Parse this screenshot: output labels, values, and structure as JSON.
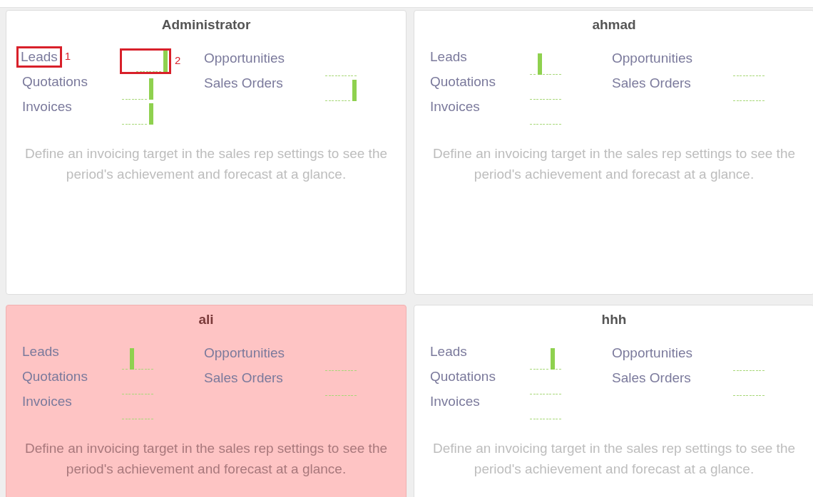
{
  "cards": [
    {
      "title": "Administrator",
      "highlighted": false,
      "left": [
        {
          "label": "Leads",
          "kind": "last",
          "label_marker": "1",
          "chart_marker": "2"
        },
        {
          "label": "Quotations",
          "kind": "last"
        },
        {
          "label": "Invoices",
          "kind": "last"
        }
      ],
      "right": [
        {
          "label": "Opportunities",
          "kind": "flat"
        },
        {
          "label": "Sales Orders",
          "kind": "last"
        }
      ],
      "message": "Define an invoicing target in the sales rep settings to see the period's achievement and forecast at a glance."
    },
    {
      "title": "ahmad",
      "highlighted": false,
      "left": [
        {
          "label": "Leads",
          "kind": "second"
        },
        {
          "label": "Quotations",
          "kind": "flat"
        },
        {
          "label": "Invoices",
          "kind": "flat"
        }
      ],
      "right": [
        {
          "label": "Opportunities",
          "kind": "flat"
        },
        {
          "label": "Sales Orders",
          "kind": "flat"
        }
      ],
      "message": "Define an invoicing target in the sales rep settings to see the period's achievement and forecast at a glance."
    },
    {
      "title": "ali",
      "highlighted": true,
      "left": [
        {
          "label": "Leads",
          "kind": "second"
        },
        {
          "label": "Quotations",
          "kind": "flat"
        },
        {
          "label": "Invoices",
          "kind": "flat"
        }
      ],
      "right": [
        {
          "label": "Opportunities",
          "kind": "flat"
        },
        {
          "label": "Sales Orders",
          "kind": "flat"
        }
      ],
      "message": "Define an invoicing target in the sales rep settings to see the period's achievement and forecast at a glance."
    },
    {
      "title": "hhh",
      "highlighted": false,
      "left": [
        {
          "label": "Leads",
          "kind": "fourth"
        },
        {
          "label": "Quotations",
          "kind": "flat"
        },
        {
          "label": "Invoices",
          "kind": "flat"
        }
      ],
      "right": [
        {
          "label": "Opportunities",
          "kind": "flat"
        },
        {
          "label": "Sales Orders",
          "kind": "flat"
        }
      ],
      "message": "Define an invoicing target in the sales rep settings to see the period's achievement and forecast at a glance."
    }
  ]
}
